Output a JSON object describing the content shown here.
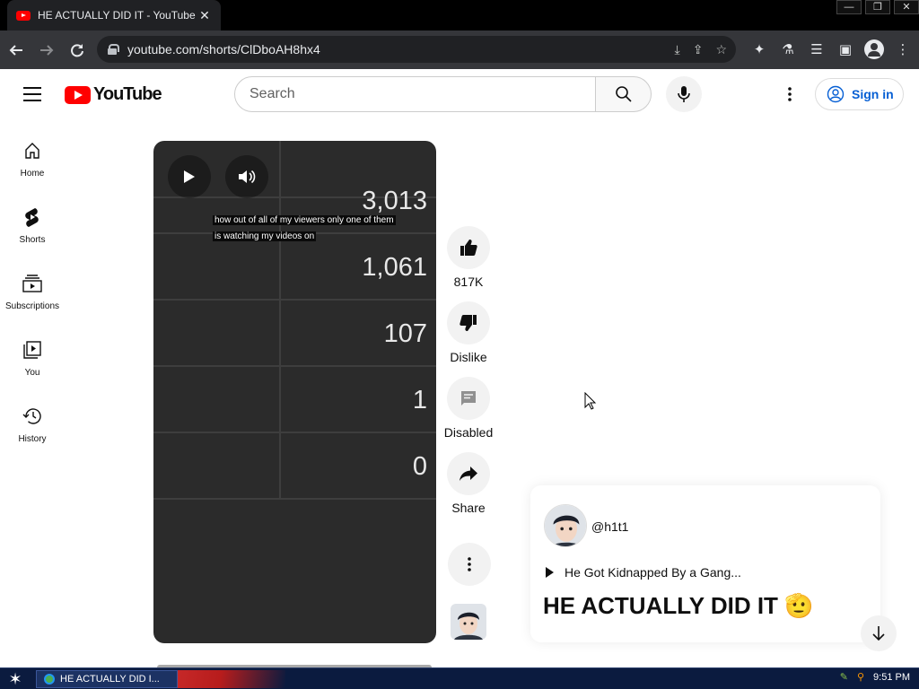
{
  "browser": {
    "tab_title": "HE ACTUALLY DID IT  - YouTube",
    "tab_close": "✕",
    "url": "youtube.com/shorts/ClDboAH8hx4",
    "window_controls": [
      "—",
      "❐",
      "✕"
    ]
  },
  "header": {
    "brand": "YouTube",
    "search_placeholder": "Search",
    "signin_label": "Sign in"
  },
  "guide": {
    "items": [
      {
        "label": "Home",
        "icon": "home-icon"
      },
      {
        "label": "Shorts",
        "icon": "shorts-icon"
      },
      {
        "label": "Subscriptions",
        "icon": "subscriptions-icon"
      },
      {
        "label": "You",
        "icon": "you-icon"
      },
      {
        "label": "History",
        "icon": "history-icon"
      }
    ]
  },
  "player": {
    "table_values": [
      "3,013",
      "1,061",
      "107",
      "1",
      "0"
    ],
    "caption": "how out of all of my viewers only one of them is watching my videos on"
  },
  "actions": {
    "like_count": "817K",
    "dislike_label": "Dislike",
    "comments_label": "Disabled",
    "share_label": "Share"
  },
  "info": {
    "channel_handle": "@h1t1",
    "playlist_title": "He Got Kidnapped By a Gang...",
    "short_title": "HE ACTUALLY DID IT 🫡"
  },
  "taskbar": {
    "window_label": "HE ACTUALLY DID I...",
    "clock": "9:51 PM"
  },
  "colors": {
    "brand_red": "#ff0000",
    "link_blue": "#065fd4",
    "player_bg": "#2b2b2b",
    "chrome_toolbar": "#35363a"
  }
}
